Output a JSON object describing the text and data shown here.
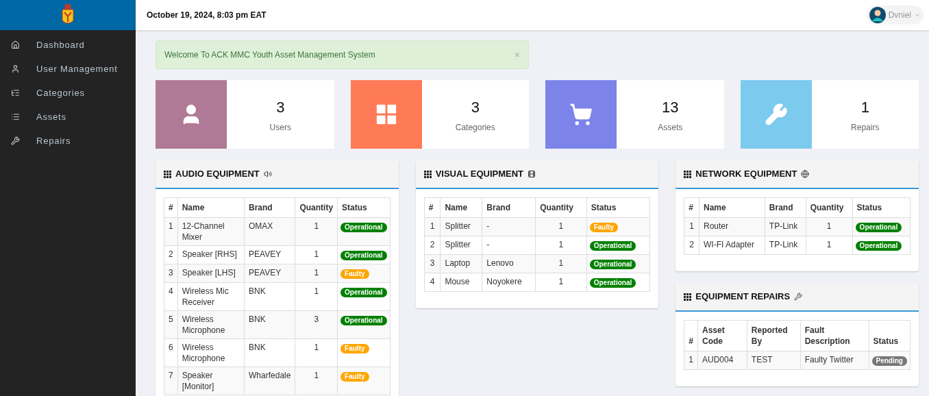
{
  "header": {
    "datetime": "October 19, 2024, 8:03 pm EAT",
    "user": "Dvniel"
  },
  "sidebar": {
    "items": [
      {
        "label": "Dashboard"
      },
      {
        "label": "User Management"
      },
      {
        "label": "Categories"
      },
      {
        "label": "Assets"
      },
      {
        "label": "Repairs"
      }
    ]
  },
  "alert": {
    "text": "Welcome To ACK MMC Youth Asset Management System",
    "close": "×"
  },
  "stats": [
    {
      "value": "3",
      "label": "Users",
      "color": "#b07996"
    },
    {
      "value": "3",
      "label": "Categories",
      "color": "#ff7a56"
    },
    {
      "value": "13",
      "label": "Assets",
      "color": "#7c84ea"
    },
    {
      "value": "1",
      "label": "Repairs",
      "color": "#7ccaee"
    }
  ],
  "panels": [
    {
      "title": "AUDIO EQUIPMENT",
      "columns": [
        "#",
        "Name",
        "Brand",
        "Quantity",
        "Status"
      ],
      "rows": [
        {
          "cells": [
            "1",
            "12-Channel Mixer",
            "OMAX",
            "1"
          ],
          "status": {
            "label": "Operational",
            "color": "#008000"
          }
        },
        {
          "cells": [
            "2",
            "Speaker [RHS]",
            "PEAVEY",
            "1"
          ],
          "status": {
            "label": "Operational",
            "color": "#008000"
          }
        },
        {
          "cells": [
            "3",
            "Speaker [LHS]",
            "PEAVEY",
            "1"
          ],
          "status": {
            "label": "Faulty",
            "color": "#ffa500"
          }
        },
        {
          "cells": [
            "4",
            "Wireless Mic Receiver",
            "BNK",
            "1"
          ],
          "status": {
            "label": "Operational",
            "color": "#008000"
          }
        },
        {
          "cells": [
            "5",
            "Wireless Microphone",
            "BNK",
            "3"
          ],
          "status": {
            "label": "Operational",
            "color": "#008000"
          }
        },
        {
          "cells": [
            "6",
            "Wireless Microphone",
            "BNK",
            "1"
          ],
          "status": {
            "label": "Faulty",
            "color": "#ffa500"
          }
        },
        {
          "cells": [
            "7",
            "Speaker [Monitor]",
            "Wharfedale",
            "1"
          ],
          "status": {
            "label": "Faulty",
            "color": "#ffa500"
          }
        }
      ]
    },
    {
      "title": "VISUAL EQUIPMENT",
      "columns": [
        "#",
        "Name",
        "Brand",
        "Quantity",
        "Status"
      ],
      "rows": [
        {
          "cells": [
            "1",
            "Splitter",
            "-",
            "1"
          ],
          "status": {
            "label": "Faulty",
            "color": "#ffa500"
          }
        },
        {
          "cells": [
            "2",
            "Splitter",
            "-",
            "1"
          ],
          "status": {
            "label": "Operational",
            "color": "#008000"
          }
        },
        {
          "cells": [
            "3",
            "Laptop",
            "Lenovo",
            "1"
          ],
          "status": {
            "label": "Operational",
            "color": "#008000"
          }
        },
        {
          "cells": [
            "4",
            "Mouse",
            "Noyokere",
            "1"
          ],
          "status": {
            "label": "Operational",
            "color": "#008000"
          }
        }
      ]
    },
    {
      "title": "NETWORK EQUIPMENT",
      "columns": [
        "#",
        "Name",
        "Brand",
        "Quantity",
        "Status"
      ],
      "rows": [
        {
          "cells": [
            "1",
            "Router",
            "TP-Link",
            "1"
          ],
          "status": {
            "label": "Operational",
            "color": "#008000"
          }
        },
        {
          "cells": [
            "2",
            "WI-FI Adapter",
            "TP-Link",
            "1"
          ],
          "status": {
            "label": "Operational",
            "color": "#008000"
          }
        }
      ]
    },
    {
      "title": "EQUIPMENT REPAIRS",
      "columns": [
        "#",
        "Asset Code",
        "Reported By",
        "Fault Description",
        "Status"
      ],
      "rows": [
        {
          "cells": [
            "1",
            "AUD004",
            "TEST",
            "Faulty Twitter"
          ],
          "status": {
            "label": "Pending",
            "color": "#777777"
          }
        }
      ]
    }
  ]
}
